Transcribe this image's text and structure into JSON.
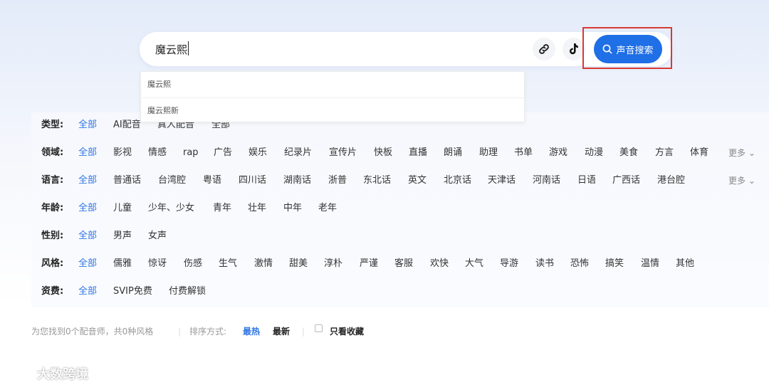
{
  "search": {
    "value": "魔云熙",
    "button_label": "声音搜索",
    "link_icon": "link-icon",
    "music_icon": "tiktok-music-icon",
    "search_icon": "magnifier-icon"
  },
  "suggestions": [
    "魔云熙",
    "魔云熙新"
  ],
  "filters": {
    "type": {
      "label": "类型:",
      "options": [
        "全部",
        "AI配音",
        "真人配音",
        "全部"
      ]
    },
    "domain": {
      "label": "领域:",
      "options": [
        "全部",
        "影视",
        "情感",
        "rap",
        "广告",
        "娱乐",
        "纪录片",
        "宣传片",
        "快板",
        "直播",
        "朗诵",
        "助理",
        "书单",
        "游戏",
        "动漫",
        "美食",
        "方言",
        "体育"
      ],
      "more": "更多"
    },
    "language": {
      "label": "语言:",
      "options": [
        "全部",
        "普通话",
        "台湾腔",
        "粤语",
        "四川话",
        "湖南话",
        "浙普",
        "东北话",
        "英文",
        "北京话",
        "天津话",
        "河南话",
        "日语",
        "广西话",
        "港台腔"
      ],
      "more": "更多"
    },
    "age": {
      "label": "年龄:",
      "options": [
        "全部",
        "儿童",
        "少年、少女",
        "青年",
        "壮年",
        "中年",
        "老年"
      ]
    },
    "gender": {
      "label": "性别:",
      "options": [
        "全部",
        "男声",
        "女声"
      ]
    },
    "style": {
      "label": "风格:",
      "options": [
        "全部",
        "儒雅",
        "惊讶",
        "伤感",
        "生气",
        "激情",
        "甜美",
        "淳朴",
        "严谨",
        "客服",
        "欢快",
        "大气",
        "导游",
        "读书",
        "恐怖",
        "搞笑",
        "温情",
        "其他"
      ]
    },
    "fee": {
      "label": "资费:",
      "options": [
        "全部",
        "SVIP免费",
        "付费解锁"
      ]
    }
  },
  "results": {
    "summary": "为您找到0个配音师，共0种风格",
    "sort_label": "排序方式:",
    "sort_hot": "最热",
    "sort_new": "最新",
    "only_favorites": "只看收藏"
  },
  "watermark": "大数跨境",
  "colors": {
    "accent": "#1f6fe6",
    "active_option": "#2f76e3",
    "highlight_box": "#d73a34"
  }
}
